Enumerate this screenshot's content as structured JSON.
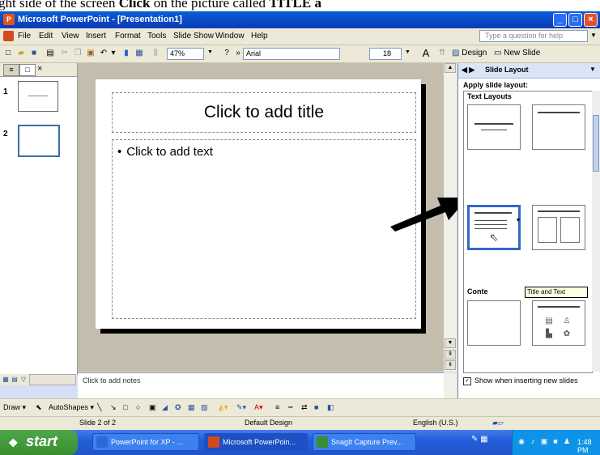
{
  "caption": {
    "lead": "ght side of the screen",
    "click": "Click",
    "rest": "on the picture called",
    "title": "TITLE a"
  },
  "window": {
    "title": "Microsoft PowerPoint - [Presentation1]",
    "min": "_",
    "max": "□",
    "close": "×"
  },
  "menu": {
    "items": [
      "File",
      "Edit",
      "View",
      "Insert",
      "Format",
      "Tools",
      "Slide Show",
      "Window",
      "Help"
    ],
    "help_placeholder": "Type a question for help"
  },
  "toolbar": {
    "zoom": "47%",
    "font": "Arial",
    "size": "18",
    "design": "Design",
    "new_slide": "New Slide"
  },
  "left_pane": {
    "tab_outline": "≡",
    "tab_slides": "□",
    "close": "×",
    "slide_numbers": [
      "1",
      "2"
    ]
  },
  "slide": {
    "title_placeholder": "Click to add title",
    "body_placeholder": "Click to add text",
    "bullet": "•"
  },
  "notes": {
    "placeholder": "Click to add notes"
  },
  "task_pane": {
    "title": "Slide Layout",
    "apply_label": "Apply slide layout:",
    "text_layouts_label": "Text Layouts",
    "content_label": "Conte",
    "tooltip": "Title and Text",
    "show_when_inserting": "Show when inserting new slides",
    "show_checked": "✓"
  },
  "drawbar": {
    "draw": "Draw ▾",
    "autoshapes": "AutoShapes ▾"
  },
  "status": {
    "slide": "Slide 2 of 2",
    "design": "Default Design",
    "language": "English (U.S.)"
  },
  "taskbar": {
    "start": "start",
    "buttons": [
      "PowerPoint for XP - ...",
      "Microsoft PowerPoin...",
      "SnagIt Capture Prev..."
    ],
    "clock": "1:48 PM"
  },
  "colors": {
    "title_bar": "#0b46c3",
    "arrow": "#000000",
    "selected_layout": "#3169c6",
    "start": "#3a8e2f"
  }
}
